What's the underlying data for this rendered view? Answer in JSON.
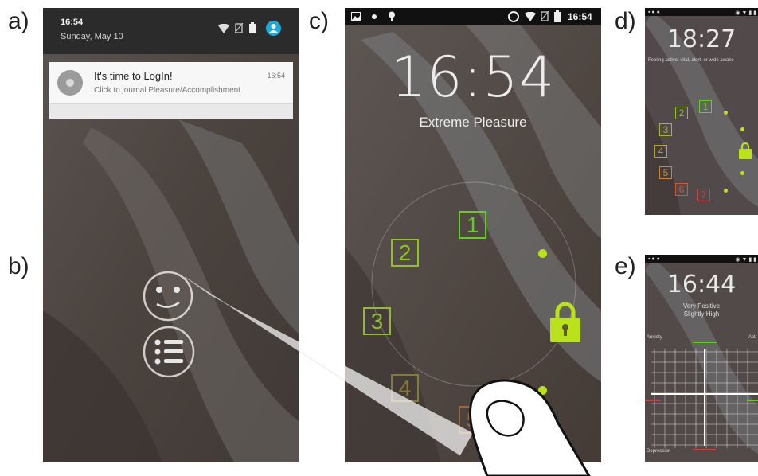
{
  "panel_labels": {
    "a": "a)",
    "b": "b)",
    "c": "c)",
    "d": "d)",
    "e": "e)"
  },
  "panel_a": {
    "status_time": "16:54",
    "status_date": "Sunday, May 10",
    "notification": {
      "title": "It's time to LogIn!",
      "time": "16:54",
      "body": "Click to journal Pleasure/Accomplishment."
    },
    "icons": [
      "wifi-icon",
      "no-sim-icon",
      "battery-icon",
      "account-icon"
    ]
  },
  "panel_b": {
    "buttons": [
      "smiley-icon",
      "list-icon"
    ]
  },
  "panel_c": {
    "status_time": "16:54",
    "clock": "16:54",
    "mood_label": "Extreme Pleasure",
    "options": [
      "1",
      "2",
      "3",
      "4",
      "5"
    ],
    "unlock": "lock-icon"
  },
  "panel_d": {
    "clock": "18:27",
    "description": "Feeling active, vital, alert, or wide awake",
    "options": [
      "1",
      "2",
      "3",
      "4",
      "5",
      "6",
      "7"
    ],
    "unlock": "lock-icon"
  },
  "panel_e": {
    "clock": "16:44",
    "line1": "Very Positive",
    "line2": "Slightly High",
    "axis_top_left": "Anxiety",
    "axis_top_right": "Acti",
    "axis_bottom_left": "Depression"
  },
  "colors": {
    "bright_green": "#5fd11d",
    "lime": "#b9e21b",
    "mid_green": "#8fb83c",
    "olive": "#b2a13d",
    "orange": "#c9833a",
    "red": "#cc4040"
  }
}
